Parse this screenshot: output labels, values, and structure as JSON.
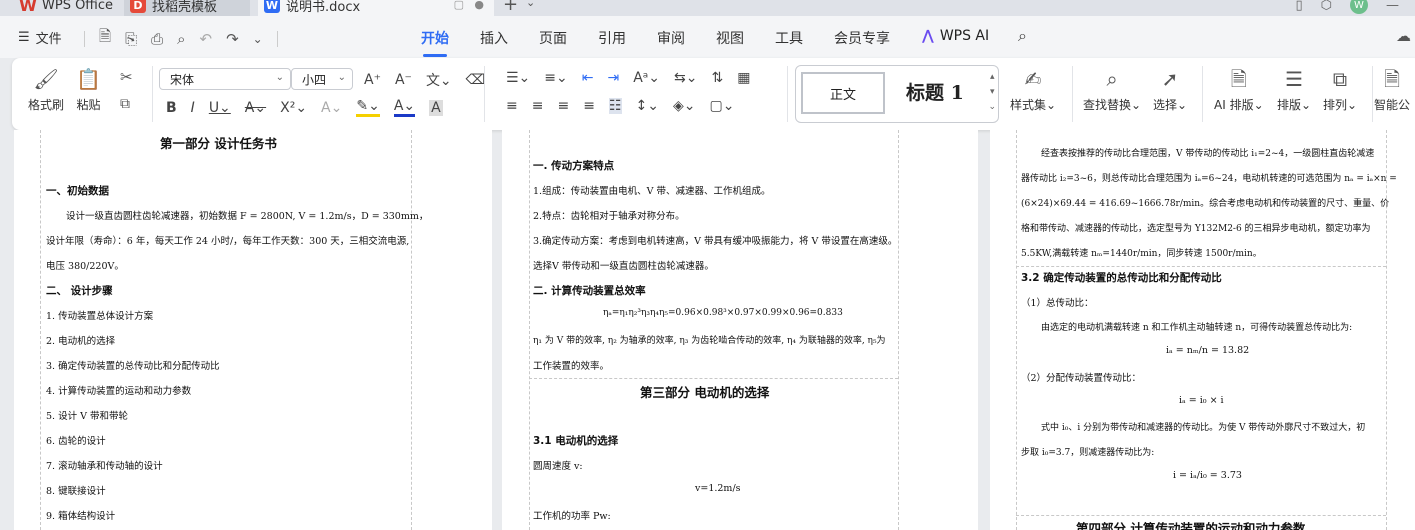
{
  "tabs": [
    {
      "label": "WPS Office"
    },
    {
      "label": "找稻壳模板"
    },
    {
      "label": "说明书.docx"
    }
  ],
  "menubar": {
    "file": "文件",
    "menus": [
      "开始",
      "插入",
      "页面",
      "引用",
      "审阅",
      "视图",
      "工具",
      "会员专享"
    ],
    "ai": "WPS AI"
  },
  "ribbon": {
    "format_painter": "格式刷",
    "paste": "粘贴",
    "font_name": "宋体",
    "font_size": "小四",
    "style_normal": "正文",
    "style_heading": "标题 1",
    "style_set": "样式集",
    "find_replace": "查找替换",
    "select": "选择",
    "ai_layout": "AI 排版",
    "layout": "排版",
    "arrange": "排列",
    "smart": "智能公"
  },
  "page1": {
    "title": "第一部分    设计任务书",
    "h1": "一、初始数据",
    "p1": "设计一级直齿圆柱齿轮减速器，初始数据 F = 2800N, V = 1.2m/s，D = 330mm，",
    "p2": "设计年限（寿命）：6 年，每天工作 24 小时/，每年工作天数：300 天，三相交流电源,",
    "p3": "电压 380/220V。",
    "h2": "二、 设计步骤",
    "steps": [
      "1.    传动装置总体设计方案",
      "2.    电动机的选择",
      "3.    确定传动装置的总传动比和分配传动比",
      "4.    计算传动装置的运动和动力参数",
      "5.    设计 V 带和带轮",
      "6.    齿轮的设计",
      "7.    滚动轴承和传动轴的设计",
      "8.    键联接设计",
      "9.    箱体结构设计"
    ]
  },
  "page2": {
    "h1": "一. 传动方案特点",
    "l1": "1.组成：传动装置由电机、V 带、减速器、工作机组成。",
    "l2": "2.特点：齿轮相对于轴承对称分布。",
    "l3": "3.确定传动方案：考虑到电机转速高，V 带具有缓冲吸振能力，将 V 带设置在高速级。",
    "l4": "选择V 带传动和一级直齿圆柱齿轮减速器。",
    "h2": "二. 计算传动装置总效率",
    "formula": "ηₐ=η₁η₂³η₃η₄η₅=0.96×0.98³×0.97×0.99×0.96=0.833",
    "l5": "η₁ 为 V 带的效率, η₂ 为轴承的效率, η₃ 为齿轮啮合传动的效率, η₄ 为联轴器的效率, η₅为",
    "l6": "工作装置的效率。",
    "title3": "第三部分    电动机的选择",
    "h3": "3.1  电动机的选择",
    "l7": "圆周速度 v:",
    "l8": "v=1.2m/s",
    "l9": "工作机的功率 Pw:"
  },
  "page3": {
    "p1": "经查表按推荐的传动比合理范围，V 带传动的传动比 i₁=2~4，一级圆柱直齿轮减速",
    "p2": "器传动比 i₂=3~6，则总传动比合理范围为 iₐ=6~24，电动机转速的可选范围为 nₐ = iₐ×n =",
    "p3": "(6×24)×69.44 = 416.69~1666.78r/min。综合考虑电动机和传动装置的尺寸、重量、价",
    "p4": "格和带传动、减速器的传动比，选定型号为 Y132M2-6 的三相异步电动机，额定功率为",
    "p5": "5.5KW,满载转速 nₘ=1440r/min，同步转速 1500r/min。",
    "h1": "3.2  确定传动装置的总传动比和分配传动比",
    "s1": "（1）总传动比：",
    "s1t": "由选定的电动机满载转速 n  和工作机主动轴转速 n，可得传动装置总传动比为:",
    "f1": "iₐ = nₘ/n = 13.82",
    "s2": "（2）分配传动装置传动比：",
    "f2": "iₐ = i₀ × i",
    "s2t1": "式中 i₀、i 分别为带传动和减速器的传动比。为使 V 带传动外廓尺寸不致过大，初",
    "s2t2": "步取 i₀=3.7，则减速器传动比为:",
    "f3": "i = iₐ/i₀ = 3.73",
    "title4": "第四部分    计算传动装置的运动和动力参数"
  }
}
